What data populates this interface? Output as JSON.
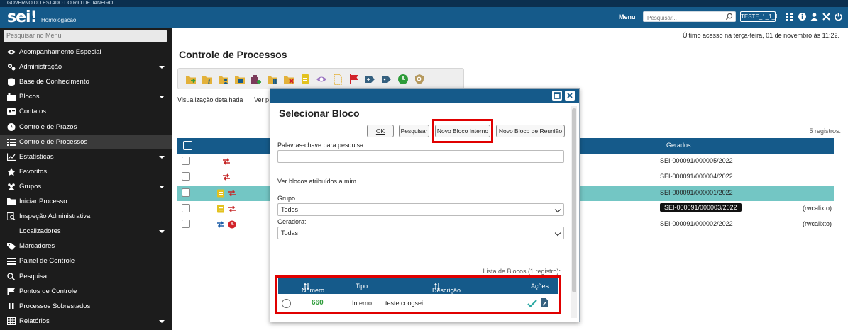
{
  "header": {
    "gov_strip": "GOVERNO DO ESTADO DO RIO DE JANEIRO",
    "logo": "sei",
    "logo_mark": "!",
    "environment": "Homologacao",
    "menu_label": "Menu",
    "search_placeholder": "Pesquisar...",
    "unit": "TESTE_1_1_1",
    "icons": [
      "grid-icon",
      "info-icon",
      "user-icon",
      "tools-icon",
      "power-icon"
    ]
  },
  "sidebar": {
    "search_placeholder": "Pesquisar no Menu",
    "items": [
      {
        "label": "Acompanhamento Especial",
        "icon": "eye-icon",
        "caret": false
      },
      {
        "label": "Administração",
        "icon": "gears-icon",
        "caret": true
      },
      {
        "label": "Base de Conhecimento",
        "icon": "database-icon",
        "caret": false
      },
      {
        "label": "Blocos",
        "icon": "blocks-icon",
        "caret": true
      },
      {
        "label": "Contatos",
        "icon": "contact-card-icon",
        "caret": false
      },
      {
        "label": "Controle de Prazos",
        "icon": "clock-icon",
        "caret": false
      },
      {
        "label": "Controle de Processos",
        "icon": "list-icon",
        "caret": false,
        "active": true
      },
      {
        "label": "Estatísticas",
        "icon": "chart-icon",
        "caret": true
      },
      {
        "label": "Favoritos",
        "icon": "star-icon",
        "caret": false
      },
      {
        "label": "Grupos",
        "icon": "users-icon",
        "caret": true
      },
      {
        "label": "Iniciar Processo",
        "icon": "folder-icon",
        "caret": false
      },
      {
        "label": "Inspeção Administrativa",
        "icon": "inspect-icon",
        "caret": false
      },
      {
        "label": "Localizadores",
        "icon": "",
        "caret": true
      },
      {
        "label": "Marcadores",
        "icon": "tag-icon",
        "caret": false
      },
      {
        "label": "Painel de Controle",
        "icon": "panel-icon",
        "caret": false
      },
      {
        "label": "Pesquisa",
        "icon": "search-icon",
        "caret": false
      },
      {
        "label": "Pontos de Controle",
        "icon": "flag-icon",
        "caret": false
      },
      {
        "label": "Processos Sobrestados",
        "icon": "pause-icon",
        "caret": false
      },
      {
        "label": "Relatórios",
        "icon": "table-icon",
        "caret": true
      }
    ]
  },
  "main": {
    "last_access": "Último acesso na terça-feira, 01 de novembro às 11:22.",
    "title": "Controle de Processos",
    "view_detailed": "Visualização detalhada",
    "view_other": "Ver p",
    "record_count": "5 registros:",
    "column_gerados": "Gerados",
    "rows": [
      {
        "process": "SEI-000091/000005/2022",
        "extra": "",
        "highlight": false,
        "dark": false
      },
      {
        "process": "SEI-000091/000004/2022",
        "extra": "",
        "highlight": false,
        "dark": false
      },
      {
        "process": "SEI-000091/000001/2022",
        "extra": "",
        "highlight": true,
        "dark": false
      },
      {
        "process": "SEI-000091/000003/2022",
        "extra": "(rwcalixto)",
        "highlight": false,
        "dark": true
      },
      {
        "process": "SEI-000091/000002/2022",
        "extra": "(rwcalixto)",
        "highlight": false,
        "dark": false
      }
    ]
  },
  "modal": {
    "title": "Selecionar Bloco",
    "btn_ok": "OK",
    "btn_pesquisar": "Pesquisar",
    "btn_novo_interno": "Novo Bloco Interno",
    "btn_novo_reuniao": "Novo Bloco de Reunião",
    "keywords_label": "Palavras-chave para pesquisa:",
    "keywords_value": "",
    "assigned_link": "Ver blocos atribuídos a mim",
    "grupo_label": "Grupo",
    "grupo_value": "Todos",
    "geradora_label": "Geradora:",
    "geradora_value": "Todas",
    "list_caption": "Lista de Blocos (1 registro):",
    "columns": {
      "numero": "Número",
      "tipo": "Tipo",
      "descricao": "Descrição",
      "acoes": "Ações"
    },
    "rows": [
      {
        "numero": "660",
        "tipo": "Interno",
        "descricao": "teste coogsei"
      }
    ]
  },
  "colors": {
    "header_blue": "#155a8a",
    "sidebar_bg": "#1c1c1c",
    "highlight_row": "#73c6c4",
    "annotation_red": "#e00000",
    "number_green": "#2e9c3a"
  }
}
